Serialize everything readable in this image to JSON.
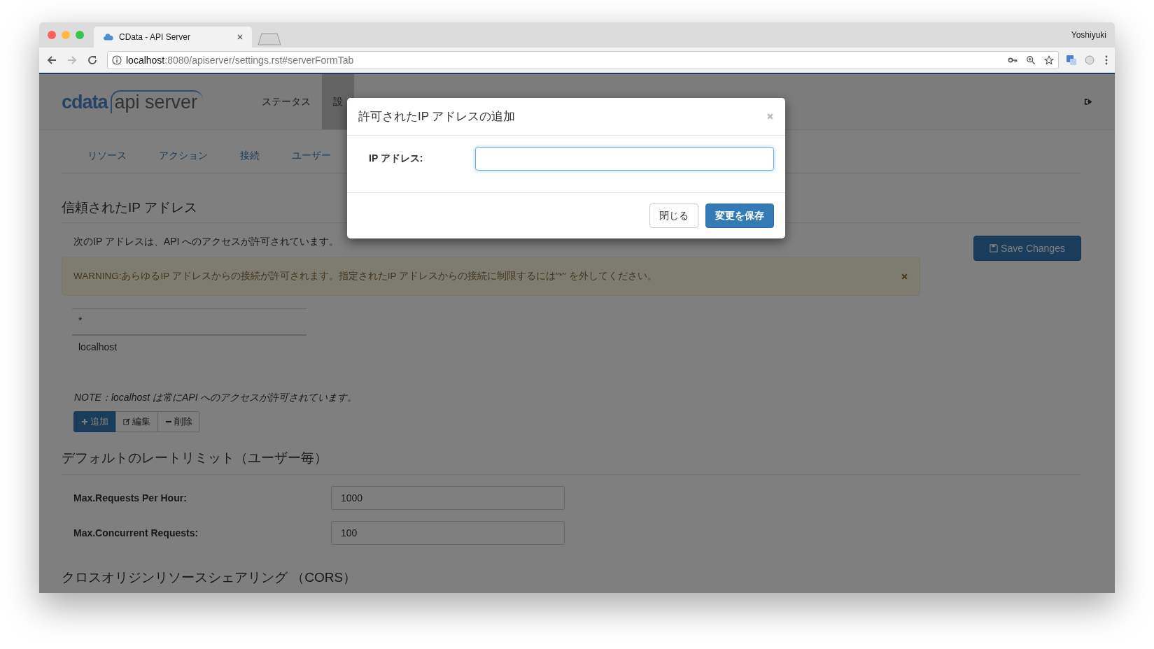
{
  "browser": {
    "tab_title": "CData - API Server",
    "profile": "Yoshiyuki",
    "url_host": "localhost",
    "url_path": ":8080/apiserver/settings.rst#serverFormTab"
  },
  "logo": {
    "brand": "cdata",
    "product": "api server"
  },
  "nav": [
    {
      "label": "ステータス",
      "selected": false
    },
    {
      "label": "設",
      "selected": true
    }
  ],
  "subtabs": [
    {
      "label": "リソース",
      "selected": false
    },
    {
      "label": "アクション",
      "selected": false
    },
    {
      "label": "接続",
      "selected": false
    },
    {
      "label": "ユーザー",
      "selected": false
    }
  ],
  "trusted": {
    "heading": "信頼されたIP アドレス",
    "description": "次のIP アドレスは、API へのアクセスが許可されています。",
    "save_button": "Save Changes",
    "warning": "WARNING:あらゆるIP アドレスからの接続が許可されます。指定されたIP アドレスからの接続に制限するには\"*\" を外してください。",
    "addresses": [
      "*",
      "localhost"
    ],
    "note": "NOTE：localhost は常にAPI へのアクセスが許可されています。",
    "buttons": [
      {
        "label": "追加",
        "kind": "add"
      },
      {
        "label": "編集",
        "kind": "edit"
      },
      {
        "label": "削除",
        "kind": "delete"
      }
    ]
  },
  "rate_limit": {
    "heading": "デフォルトのレートリミット（ユーザー毎）",
    "fields": [
      {
        "label": "Max.Requests Per Hour:",
        "value": "1000"
      },
      {
        "label": "Max.Concurrent Requests:",
        "value": "100"
      }
    ]
  },
  "cors": {
    "heading": "クロスオリジンリソースシェアリング （CORS）"
  },
  "modal": {
    "title": "許可されたIP アドレスの追加",
    "field_label": "IP アドレス:",
    "focused": true,
    "close_button": "閉じる",
    "save_button": "変更を保存"
  }
}
